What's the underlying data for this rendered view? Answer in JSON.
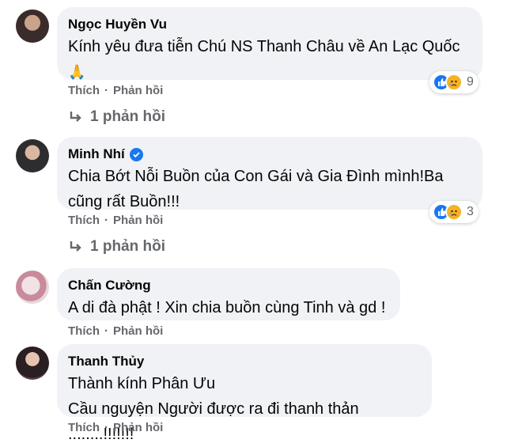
{
  "comments": [
    {
      "name": "Ngọc Huyền Vu",
      "text": "Kính yêu đưa tiễn Chú NS Thanh Châu về An Lạc Quốc",
      "emoji": "🙏",
      "reaction_count": "9",
      "replies_label": "1 phản hồi",
      "verified": false
    },
    {
      "name": "Minh Nhí",
      "text": "Chia Bớt Nỗi Buồn của Con Gái và Gia Đình mình!Ba\ncũng rất Buồn!!!",
      "reaction_count": "3",
      "replies_label": "1 phản hồi",
      "verified": true
    },
    {
      "name": "Chấn Cường",
      "text": "A di đà phật ! Xin chia buồn cùng Tinh và gd !"
    },
    {
      "name": "Thanh Thủy",
      "text": "Thành kính Phân Ưu\nCầu nguyện Người được ra đi thanh thản ........!!!!!!!"
    }
  ],
  "actions": {
    "like_label": "Thích",
    "separator": "·",
    "reply_label": "Phản hồi"
  },
  "colors": {
    "bubble": "#f0f2f5",
    "secondary_text": "#65676b",
    "like_blue": "#1877f2",
    "sad_yellow": "#f7b125"
  }
}
